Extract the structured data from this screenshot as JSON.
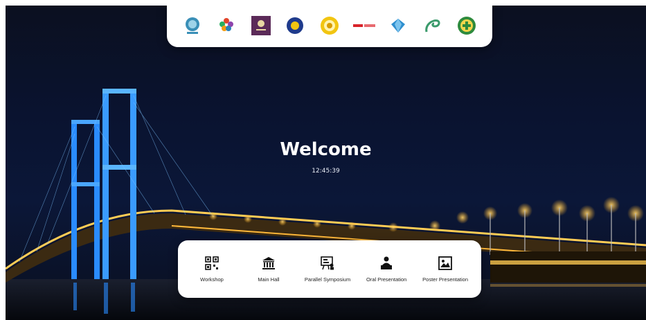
{
  "logos": [
    {
      "icon": "globe-emblem-icon",
      "color": "#3a8fb7"
    },
    {
      "icon": "colorful-flower-logo-icon",
      "color": "#e2452b"
    },
    {
      "icon": "purple-square-logo-icon",
      "color": "#5b2a58"
    },
    {
      "icon": "blue-shield-logo-icon",
      "color": "#1f3b8c"
    },
    {
      "icon": "yellow-seal-logo-icon",
      "color": "#f2c511"
    },
    {
      "icon": "red-wordmark-logo-icon",
      "color": "#d8232a"
    },
    {
      "icon": "diamond-logo-icon",
      "color": "#2f8fcf"
    },
    {
      "icon": "green-swirl-logo-icon",
      "color": "#3a9a6b"
    },
    {
      "icon": "green-cross-seal-logo-icon",
      "color": "#2e8b3d"
    }
  ],
  "hero": {
    "title": "Welcome",
    "clock": "12:45:39"
  },
  "menu": [
    {
      "label": "Workshop",
      "icon": "qr-grid-icon"
    },
    {
      "label": "Main Hall",
      "icon": "building-columns-icon"
    },
    {
      "label": "Parallel Symposium",
      "icon": "presentation-board-icon"
    },
    {
      "label": "Oral Presentation",
      "icon": "speaker-podium-icon"
    },
    {
      "label": "Poster Presentation",
      "icon": "picture-frame-icon"
    }
  ]
}
